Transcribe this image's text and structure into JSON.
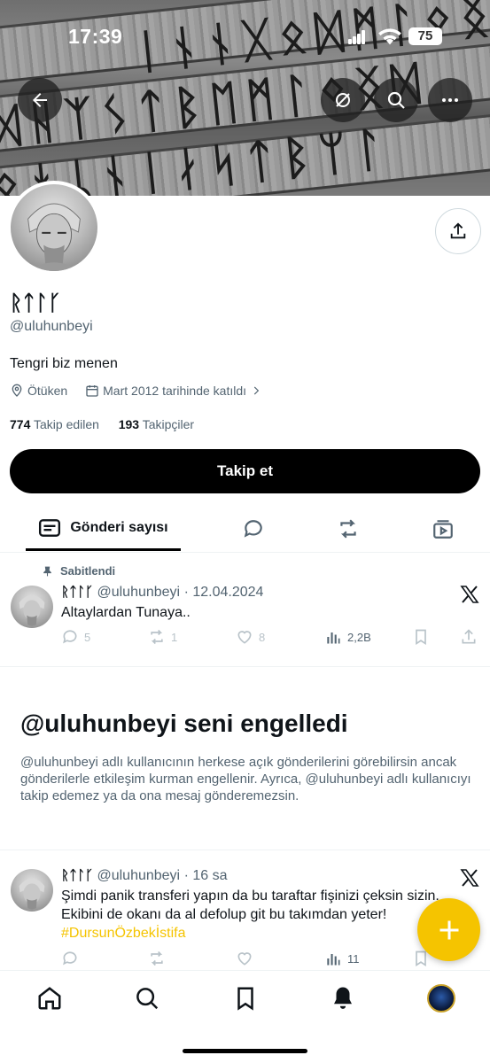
{
  "status_bar": {
    "time": "17:39",
    "battery": "75"
  },
  "profile": {
    "display_name": "ᚱᛏᛚᚴ",
    "handle": "@uluhunbeyi",
    "bio": "Tengri biz menen",
    "location": "Ötüken",
    "joined": "Mart 2012 tarihinde katıldı",
    "following_count": "774",
    "following_label": "Takip edilen",
    "followers_count": "193",
    "followers_label": "Takipçiler",
    "follow_button": "Takip et"
  },
  "tabs": {
    "active_label": "Gönderi sayısı"
  },
  "pinned_tweet": {
    "pinned_label": "Sabitlendi",
    "author": "ᚱᛏᛚᚴ",
    "handle": "@uluhunbeyi",
    "date": "· 12.04.2024",
    "text": "Altaylardan Tunaya..",
    "replies": "5",
    "retweets": "1",
    "likes": "8",
    "views": "2,2B"
  },
  "blocked_notice": {
    "title": "@uluhunbeyi seni engelledi",
    "text": "@uluhunbeyi adlı kullanıcının herkese açık gönderilerini görebilirsin ancak gönderilerle etkileşim kurman engellenir. Ayrıca, @uluhunbeyi adlı kullanıcıyı takip edemez ya da ona mesaj gönderemezsin."
  },
  "second_tweet": {
    "author": "ᚱᛏᛚᚴ",
    "handle": "@uluhunbeyi",
    "date": "· 16 sa",
    "text_line1": "Şimdi panik transferi yapın da bu taraftar fişinizi çeksin sizin.",
    "text_line2": "Ekibini de okanı da al defolup git bu takımdan yeter!",
    "hashtag": "#DursunÖzbekİstifa",
    "views": "11"
  },
  "colors": {
    "accent": "#f5c400",
    "text": "#0f1419",
    "muted": "#536471"
  },
  "icons": [
    "back-arrow-icon",
    "unmute-icon",
    "search-icon",
    "more-icon",
    "share-icon",
    "location-icon",
    "calendar-icon",
    "posts-icon",
    "reply-icon",
    "retweet-icon",
    "media-icon",
    "pin-icon",
    "x-logo-icon",
    "like-icon",
    "views-icon",
    "bookmark-icon",
    "plus-icon",
    "home-icon",
    "notifications-icon"
  ]
}
